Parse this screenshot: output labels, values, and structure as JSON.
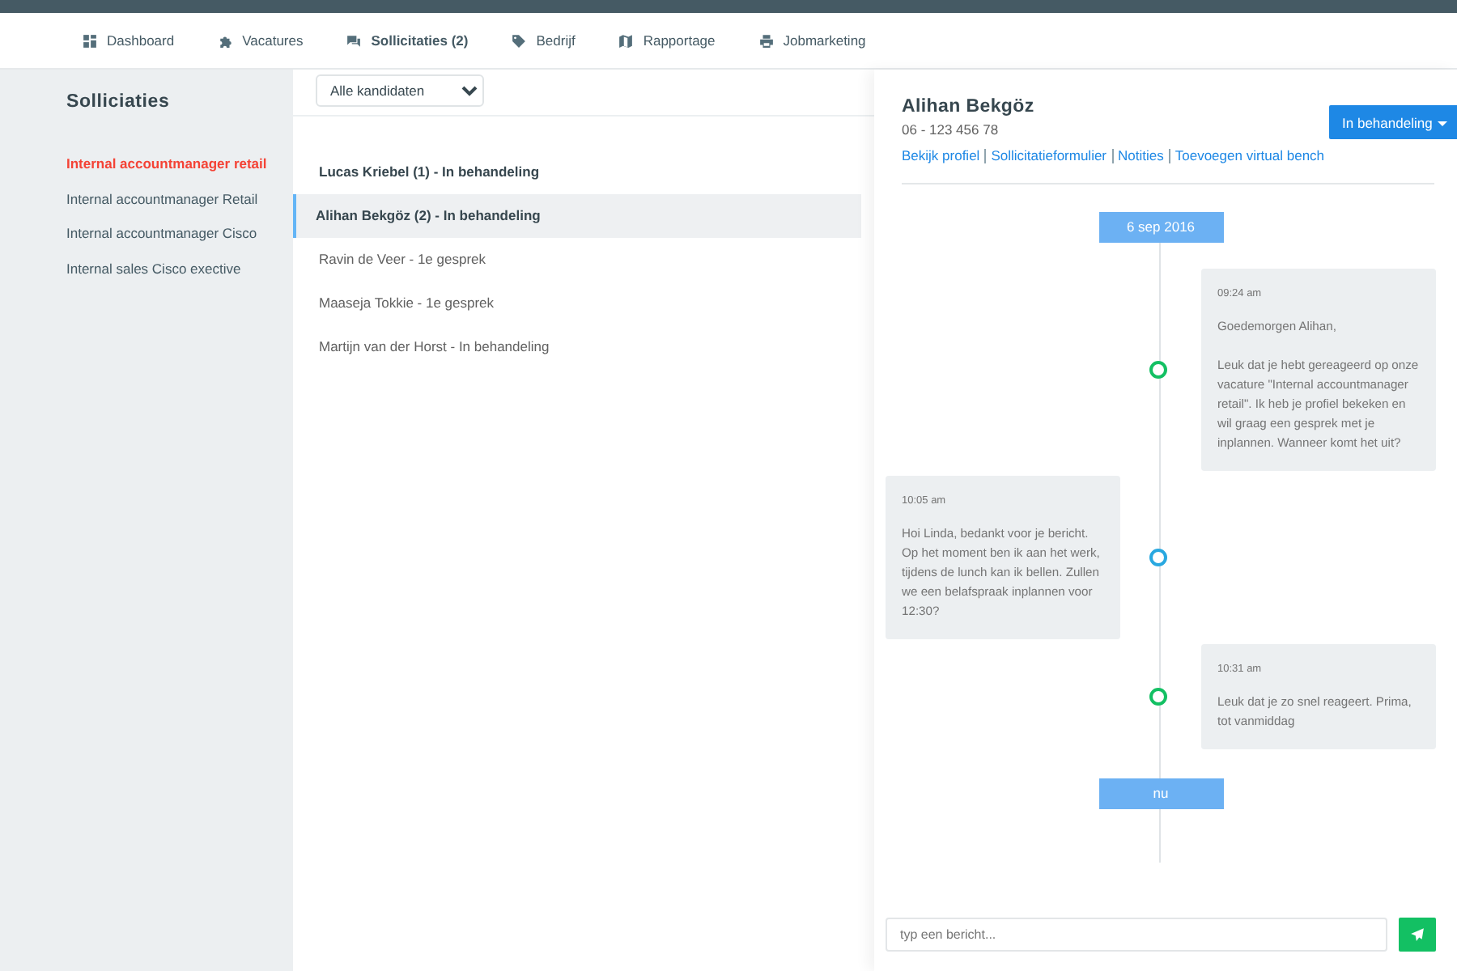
{
  "nav": {
    "items": [
      {
        "label": "Dashboard",
        "selected": false
      },
      {
        "label": "Vacatures",
        "selected": false
      },
      {
        "label": "Sollicitaties (2)",
        "selected": true
      },
      {
        "label": "Bedrijf",
        "selected": false
      },
      {
        "label": "Rapportage",
        "selected": false
      },
      {
        "label": "Jobmarketing",
        "selected": false
      }
    ]
  },
  "sidebar": {
    "title": "Solliciaties",
    "items": [
      {
        "label": "Internal accountmanager retail",
        "selected": true
      },
      {
        "label": "Internal accountmanager Retail",
        "selected": false
      },
      {
        "label": "Internal accountmanager Cisco",
        "selected": false
      },
      {
        "label": "Internal sales Cisco exective",
        "selected": false
      }
    ]
  },
  "candidates": {
    "filter": "Alle kandidaten",
    "items": [
      {
        "label": "Lucas Kriebel (1) - In behandeling",
        "unread": true,
        "selected": false
      },
      {
        "label": "Alihan Bekgöz (2) - In behandeling",
        "unread": true,
        "selected": true
      },
      {
        "label": "Ravin de Veer - 1e gesprek",
        "unread": false,
        "selected": false
      },
      {
        "label": "Maaseja Tokkie - 1e gesprek",
        "unread": false,
        "selected": false
      },
      {
        "label": "Martijn van der Horst - In behandeling",
        "unread": false,
        "selected": false
      }
    ]
  },
  "detail": {
    "name": "Alihan Bekgöz",
    "phone": "06 - 123 456 78",
    "status_button": "In behandeling",
    "links": [
      "Bekijk profiel",
      "Sollicitatieformulier",
      "Notities",
      "Toevoegen virtual bench"
    ],
    "timeline": [
      {
        "kind": "date",
        "label": "6 sep 2016"
      },
      {
        "kind": "sent",
        "time": "09:24 am",
        "paragraphs": [
          "Goedemorgen Alihan,",
          "Leuk dat je hebt gereageerd op onze vacature \"Internal accountmanager retail\". Ik heb je profiel bekeken en wil graag een gesprek met je inplannen. Wanneer komt het uit?"
        ]
      },
      {
        "kind": "received",
        "time": "10:05 am",
        "paragraphs": [
          "Hoi Linda, bedankt voor je bericht. Op het moment ben ik aan het werk, tijdens de lunch kan ik bellen. Zullen we een belafspraak inplannen voor 12:30?"
        ]
      },
      {
        "kind": "sent",
        "time": "10:31 am",
        "paragraphs": [
          "Leuk dat je zo snel reageert. Prima, tot vanmiddag"
        ]
      },
      {
        "kind": "date",
        "label": "nu"
      }
    ],
    "composer": {
      "placeholder": "typ een bericht..."
    }
  }
}
